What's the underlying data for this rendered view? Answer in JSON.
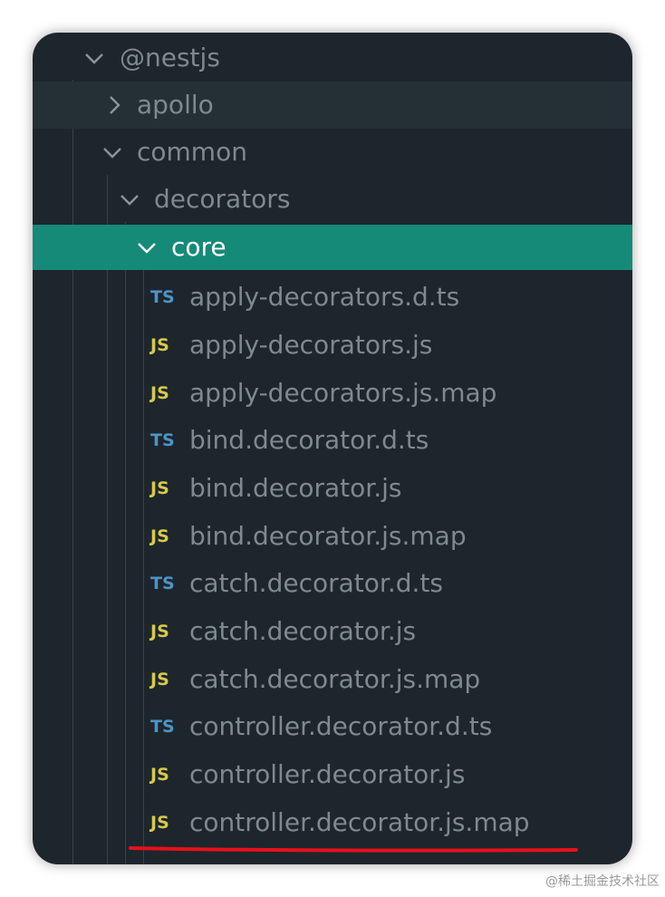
{
  "tree": {
    "folders": [
      {
        "name": "@nestjs",
        "expanded": true
      },
      {
        "name": "apollo",
        "expanded": false
      },
      {
        "name": "common",
        "expanded": true
      },
      {
        "name": "decorators",
        "expanded": true
      },
      {
        "name": "core",
        "expanded": true,
        "selected": true
      }
    ],
    "files": [
      {
        "badge": "TS",
        "name": "apply-decorators.d.ts"
      },
      {
        "badge": "JS",
        "name": "apply-decorators.js"
      },
      {
        "badge": "JS",
        "name": "apply-decorators.js.map"
      },
      {
        "badge": "TS",
        "name": "bind.decorator.d.ts"
      },
      {
        "badge": "JS",
        "name": "bind.decorator.js"
      },
      {
        "badge": "JS",
        "name": "bind.decorator.js.map"
      },
      {
        "badge": "TS",
        "name": "catch.decorator.d.ts"
      },
      {
        "badge": "JS",
        "name": "catch.decorator.js"
      },
      {
        "badge": "JS",
        "name": "catch.decorator.js.map"
      },
      {
        "badge": "TS",
        "name": "controller.decorator.d.ts"
      },
      {
        "badge": "JS",
        "name": "controller.decorator.js"
      },
      {
        "badge": "JS",
        "name": "controller.decorator.js.map"
      }
    ]
  },
  "colors": {
    "background": "#1d262c",
    "selected": "#168a79",
    "ts_badge": "#4e94c6",
    "js_badge": "#d7c94a",
    "annotation": "#e8101a"
  },
  "watermark": "@稀土掘金技术社区"
}
